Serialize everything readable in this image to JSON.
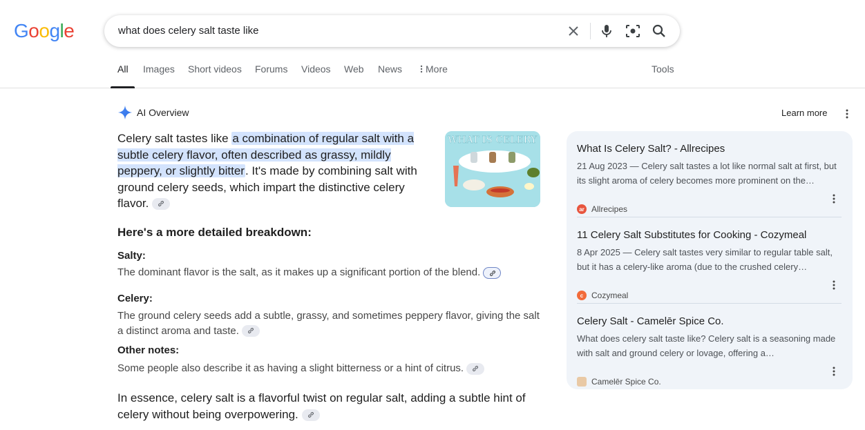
{
  "logo": "Google",
  "search": {
    "query": "what does celery salt taste like"
  },
  "tabs": [
    {
      "label": "All",
      "active": true
    },
    {
      "label": "Images"
    },
    {
      "label": "Short videos"
    },
    {
      "label": "Forums"
    },
    {
      "label": "Videos"
    },
    {
      "label": "Web"
    },
    {
      "label": "News"
    },
    {
      "label": "More"
    }
  ],
  "tools_label": "Tools",
  "ai_overview": {
    "title": "AI Overview",
    "learn_more": "Learn more",
    "intro_before": "Celery salt tastes like ",
    "intro_highlight": "a combination of regular salt with a subtle celery flavor, often described as grassy, mildly peppery, or slightly bitter",
    "intro_after": ". It's made by combining salt with ground celery seeds, which impart the distinctive celery flavor.",
    "breakdown_heading": "Here's a more detailed breakdown:",
    "sections": [
      {
        "heading": "Salty:",
        "text": "The dominant flavor is the salt, as it makes up a significant portion of the blend."
      },
      {
        "heading": "Celery:",
        "text": "The ground celery seeds add a subtle, grassy, and sometimes peppery flavor, giving the salt a distinct aroma and taste."
      },
      {
        "heading": "Other notes:",
        "text": "Some people also describe it as having a slight bitterness or a hint of citrus."
      }
    ],
    "essence": "In essence, celery salt is a flavorful twist on regular salt, adding a subtle hint of celery without being overpowering.",
    "image_text": "WHAT IS CELERY SALT"
  },
  "sources": [
    {
      "title": "What Is Celery Salt? - Allrecipes",
      "snippet": "21 Aug 2023 — Celery salt tastes a lot like normal salt at first, but its slight aroma of celery becomes more prominent on the…",
      "site": "Allrecipes",
      "favicon_color": "#e8553e"
    },
    {
      "title": "11 Celery Salt Substitutes for Cooking - Cozymeal",
      "snippet": "8 Apr 2025 — Celery salt tastes very similar to regular table salt, but it has a celery-like aroma (due to the crushed celery…",
      "site": "Cozymeal",
      "favicon_color": "#f26b3a"
    },
    {
      "title": "Celery Salt - Camelēr Spice Co.",
      "snippet": "What does celery salt taste like? Celery salt is a seasoning made with salt and ground celery or lovage, offering a…",
      "site": "Camelēr Spice Co.",
      "favicon_color": "#e9c9a5"
    }
  ]
}
